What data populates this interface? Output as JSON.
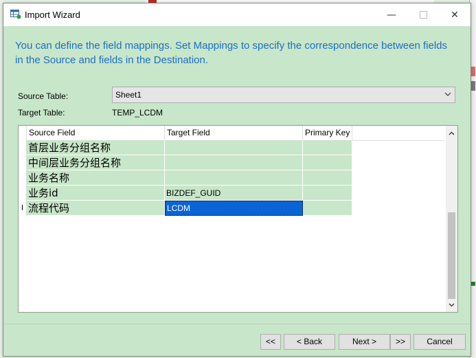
{
  "window": {
    "title": "Import Wizard",
    "minimize_glyph": "—",
    "close_glyph": "✕"
  },
  "intro_text": "You can define the field mappings. Set Mappings to specify the correspondence between fields in the Source and fields in the Destination.",
  "source_table": {
    "label": "Source Table:",
    "value": "Sheet1"
  },
  "target_table": {
    "label": "Target Table:",
    "value": "TEMP_LCDM"
  },
  "grid": {
    "columns": [
      "Source Field",
      "Target Field",
      "Primary Key"
    ],
    "current_row_marker": "I",
    "rows": [
      {
        "source": "首层业务分组名称",
        "target": "",
        "primary_key": ""
      },
      {
        "source": "中间层业务分组名称",
        "target": "",
        "primary_key": ""
      },
      {
        "source": "业务名称",
        "target": "",
        "primary_key": ""
      },
      {
        "source": "业务id",
        "target": "BIZDEF_GUID",
        "primary_key": ""
      },
      {
        "source": "流程代码",
        "target": "LCDM",
        "primary_key": ""
      }
    ]
  },
  "buttons": {
    "first": "<<",
    "back": "< Back",
    "next": "Next >",
    "last": ">>",
    "cancel": "Cancel"
  },
  "colors": {
    "intro_text": "#1a6fc4",
    "dialog_bg": "#c8e6c9",
    "selection": "#0a64d6"
  },
  "icons": [
    "import-wizard-icon",
    "chevron-down-icon",
    "scroll-up-icon",
    "scroll-down-icon"
  ]
}
